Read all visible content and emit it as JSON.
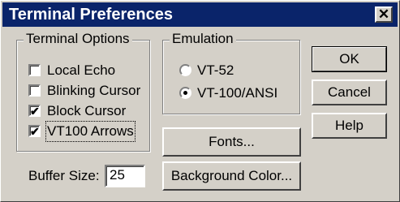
{
  "window": {
    "title": "Terminal Preferences",
    "close_glyph": "✕"
  },
  "terminal_options": {
    "legend": "Terminal Options",
    "items": [
      {
        "label": "Local Echo",
        "checked": false
      },
      {
        "label": "Blinking Cursor",
        "checked": false
      },
      {
        "label": "Block Cursor",
        "checked": true
      },
      {
        "label": "VT100 Arrows",
        "checked": true
      }
    ]
  },
  "emulation": {
    "legend": "Emulation",
    "options": [
      {
        "label": "VT-52",
        "selected": false
      },
      {
        "label": "VT-100/ANSI",
        "selected": true
      }
    ]
  },
  "buttons": {
    "ok": "OK",
    "cancel": "Cancel",
    "help": "Help",
    "fonts": "Fonts...",
    "background_color": "Background Color..."
  },
  "buffer": {
    "label": "Buffer Size:",
    "value": "25"
  },
  "check_glyph": "✔"
}
